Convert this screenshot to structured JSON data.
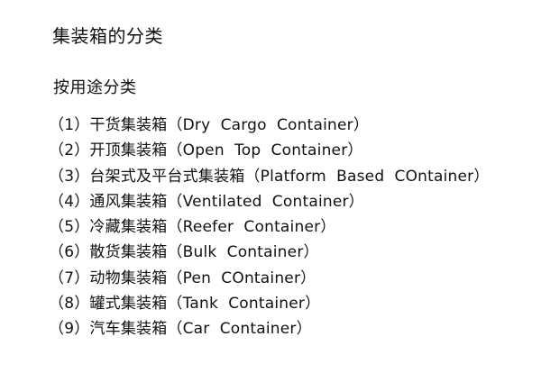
{
  "document": {
    "title": "集装箱的分类",
    "subtitle": "按用途分类",
    "items": [
      "（1）干货集装箱（Dry  Cargo  Container）",
      "（2）开顶集装箱（Open  Top  Container）",
      "（3）台架式及平台式集装箱（Platform  Based  COntainer）",
      "（4）通风集装箱（Ventilated  Container）",
      "（5）冷藏集装箱（Reefer  Container）",
      "（6）散货集装箱（Bulk  Container）",
      "（7）动物集装箱（Pen  COntainer）",
      "（8）罐式集装箱（Tank  Container）",
      "（9）汽车集装箱（Car  Container）"
    ]
  }
}
